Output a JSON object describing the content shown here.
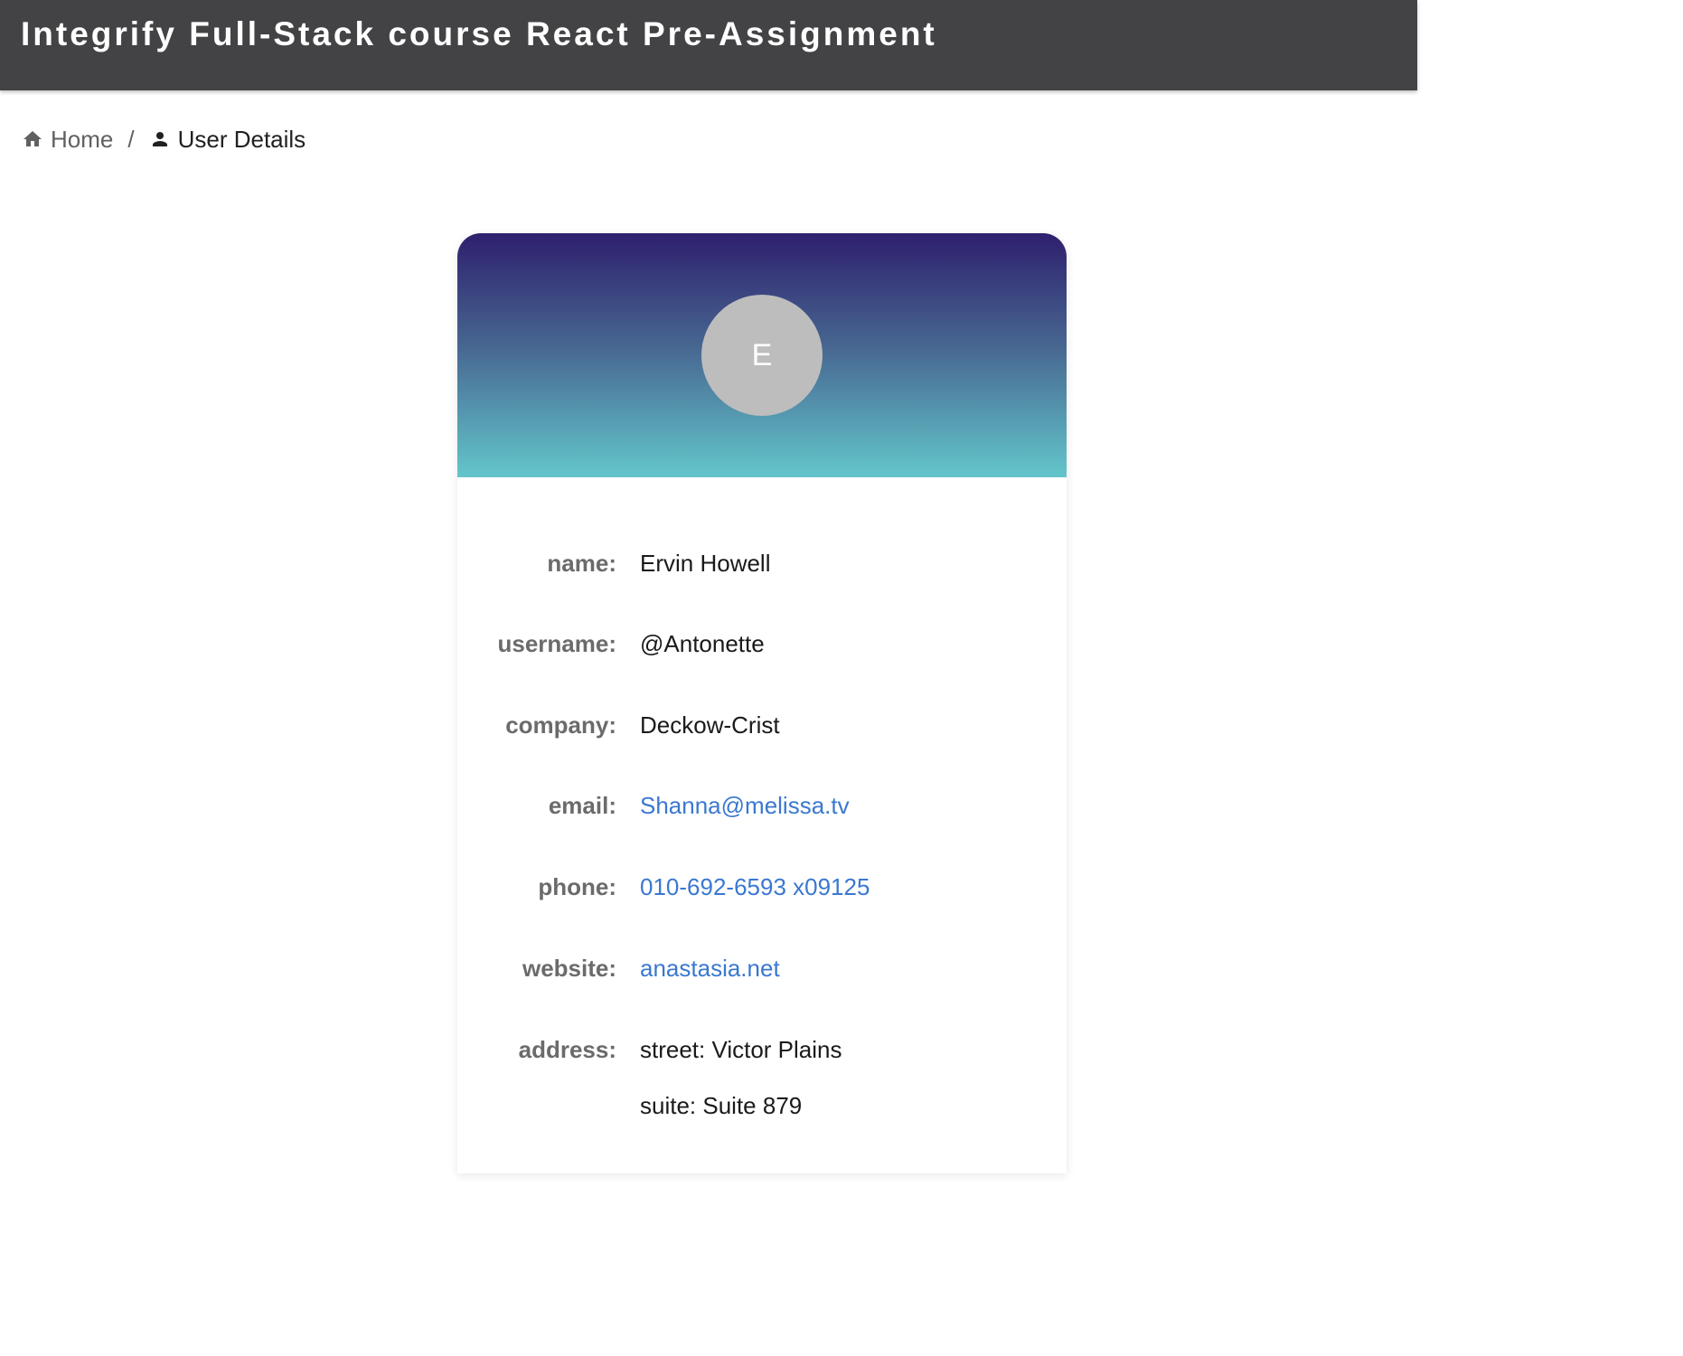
{
  "app_bar": {
    "title": "Integrify Full-Stack course React Pre-Assignment"
  },
  "breadcrumb": {
    "home_label": "Home",
    "separator": "/",
    "current_label": "User Details",
    "home_icon": "home-icon",
    "current_icon": "person-icon"
  },
  "user_card": {
    "avatar_initial": "E",
    "fields": {
      "name": {
        "label": "name:",
        "value": "Ervin Howell"
      },
      "username": {
        "label": "username:",
        "value": "@Antonette"
      },
      "company": {
        "label": "company:",
        "value": "Deckow-Crist"
      },
      "email": {
        "label": "email:",
        "value": "Shanna@melissa.tv"
      },
      "phone": {
        "label": "phone:",
        "value": "010-692-6593 x09125"
      },
      "website": {
        "label": "website:",
        "value": "anastasia.net"
      },
      "address": {
        "label": "address:",
        "street": "street: Victor Plains",
        "suite": "suite: Suite 879"
      }
    }
  },
  "colors": {
    "app_bar_bg": "#434345",
    "header_gradient_top": "#2e1f6e",
    "header_gradient_bottom": "#63c6cb",
    "avatar_bg": "#bdbdbd",
    "link": "#3a78d0",
    "label": "#6b6b6b"
  }
}
